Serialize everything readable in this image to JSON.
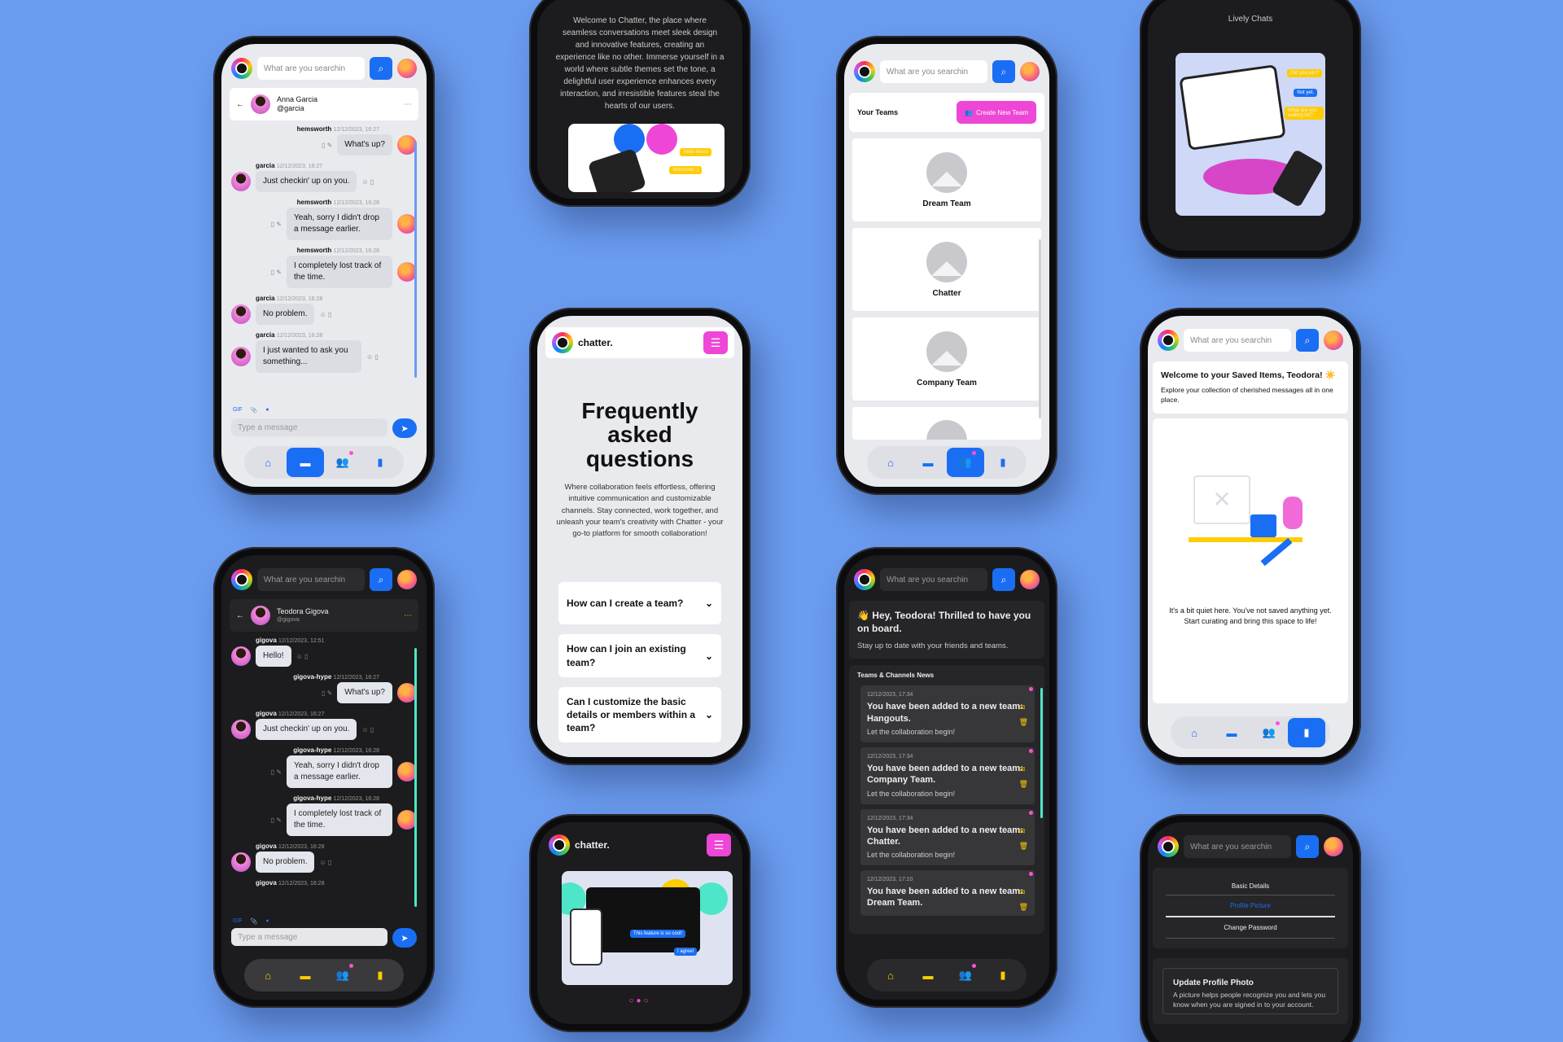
{
  "search_placeholder": "What are you searchin",
  "chat_light": {
    "name": "Anna Garcia",
    "handle": "@garcia",
    "messages": [
      {
        "author": "hemsworth",
        "time": "12/12/2023, 16:27",
        "text": "What's up?",
        "side": "right"
      },
      {
        "author": "garcia",
        "time": "12/12/2023, 16:27",
        "text": "Just checkin' up on you.",
        "side": "left"
      },
      {
        "author": "hemsworth",
        "time": "12/12/2023, 16:28",
        "text": "Yeah, sorry I didn't drop a message earlier.",
        "side": "right"
      },
      {
        "author": "hemsworth",
        "time": "12/12/2023, 16:28",
        "text": "I completely lost track of the time.",
        "side": "right"
      },
      {
        "author": "garcia",
        "time": "12/12/2023, 16:28",
        "text": "No problem.",
        "side": "left"
      },
      {
        "author": "garcia",
        "time": "12/12/2023, 16:28",
        "text": "I just wanted to ask you something...",
        "side": "left"
      }
    ],
    "gif": "GIF",
    "input_placeholder": "Type a message"
  },
  "chat_dark": {
    "name": "Teodora Gigova",
    "handle": "@gigova",
    "messages": [
      {
        "author": "gigova",
        "time": "12/12/2023, 12:51",
        "text": "Hello!",
        "side": "left"
      },
      {
        "author": "gigova-hype",
        "time": "12/12/2023, 16:27",
        "text": "What's up?",
        "side": "right"
      },
      {
        "author": "gigova",
        "time": "12/12/2023, 16:27",
        "text": "Just checkin' up on you.",
        "side": "left"
      },
      {
        "author": "gigova-hype",
        "time": "12/12/2023, 16:28",
        "text": "Yeah, sorry I didn't drop a message earlier.",
        "side": "right"
      },
      {
        "author": "gigova-hype",
        "time": "12/12/2023, 16:28",
        "text": "I completely lost track of the time.",
        "side": "right"
      },
      {
        "author": "gigova",
        "time": "12/12/2023, 16:28",
        "text": "No problem.",
        "side": "left"
      },
      {
        "author": "gigova",
        "time": "12/12/2023, 16:28",
        "text": ""
      }
    ],
    "gif": "GIF",
    "input_placeholder": "Type a message"
  },
  "welcome": {
    "text": "Welcome to Chatter, the place where seamless conversations meet sleek design and innovative features, creating an experience like no other. Immerse yourself in a world where subtle themes set the tone, a delightful user experience enhances every interaction, and irresistible features steal the hearts of our users.",
    "bubble1": "Hello there!",
    "bubble2": "Welcome! :)"
  },
  "faq": {
    "brand": "chatter.",
    "title": "Frequently asked questions",
    "intro": "Where collaboration feels effortless, offering intuitive communication and customizable channels. Stay connected, work together, and unleash your team's creativity with Chatter - your go-to platform for smooth collaboration!",
    "questions": [
      "How can I create a team?",
      "How can I join an existing team?",
      "Can I customize the basic details or members within a team?"
    ]
  },
  "carousel": {
    "brand": "chatter.",
    "bubble1": "This feature is so cool!",
    "bubble2": "I agree!"
  },
  "teams": {
    "title": "Your Teams",
    "create": "Create New Team",
    "items": [
      "Dream Team",
      "Chatter",
      "Company Team"
    ]
  },
  "home": {
    "greeting": "👋 Hey, Teodora! Thrilled to have you on board.",
    "sub": "Stay up to date with your friends and teams.",
    "section": "Teams & Channels News",
    "news": [
      {
        "time": "12/12/2023, 17:34",
        "title": "You have been added to a new team: Hangouts.",
        "sub": "Let the collaboration begin!"
      },
      {
        "time": "12/12/2023, 17:34",
        "title": "You have been added to a new team: Company Team.",
        "sub": "Let the collaboration begin!"
      },
      {
        "time": "12/12/2023, 17:34",
        "title": "You have been added to a new team: Chatter.",
        "sub": "Let the collaboration begin!"
      },
      {
        "time": "12/12/2023, 17:10",
        "title": "You have been added to a new team: Dream Team.",
        "sub": ""
      }
    ]
  },
  "lively": {
    "title": "Lively Chats",
    "b1": "Did you join?",
    "b2": "Not yet.",
    "b3": "What are you waiting for?"
  },
  "saved": {
    "title": "Welcome to your Saved Items, Teodora! ☀️",
    "sub": "Explore your collection of cherished messages all in one place.",
    "empty": "It's a bit quiet here. You've not saved anything yet. Start curating and bring this space to life!"
  },
  "settings": {
    "tabs": [
      "Basic Details",
      "Profile Picture",
      "Change Password"
    ],
    "photo_title": "Update Profile Photo",
    "photo_text": "A picture helps people recognize you and lets you know when you are signed in to your account."
  },
  "colors": {
    "primary": "#1a6ef3",
    "accent": "#ee46d6",
    "teal": "#4ee6c8",
    "yellow": "#ffcc00",
    "background": "#6b9cef"
  }
}
